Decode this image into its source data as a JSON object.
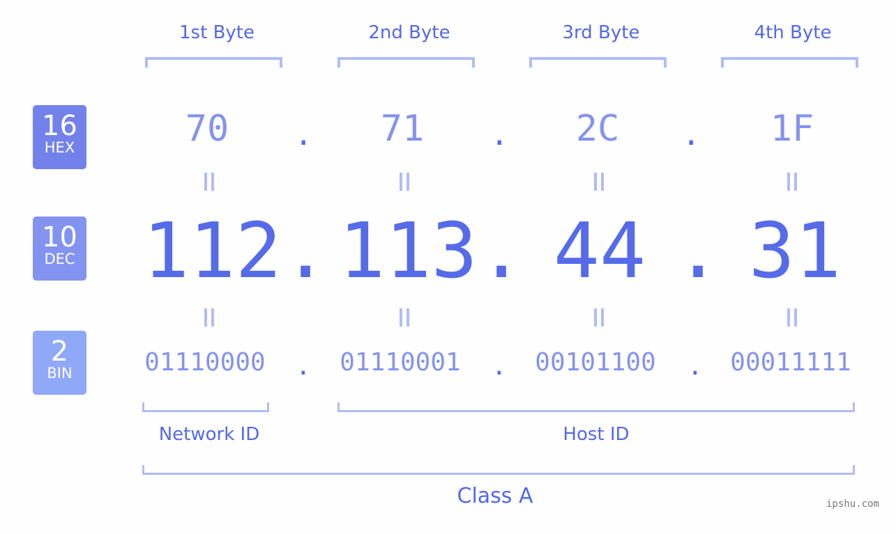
{
  "badges": [
    {
      "num": "16",
      "label": "HEX",
      "color": "#7382ea"
    },
    {
      "num": "10",
      "label": "DEC",
      "color": "#8393f0"
    },
    {
      "num": "2",
      "label": "BIN",
      "color": "#8fa8f8"
    }
  ],
  "bytes": [
    {
      "label": "1st Byte",
      "hex": "70",
      "dec": "112",
      "bin": "01110000"
    },
    {
      "label": "2nd Byte",
      "hex": "71",
      "dec": "113",
      "bin": "01110001"
    },
    {
      "label": "3rd Byte",
      "hex": "2C",
      "dec": "44",
      "bin": "00101100"
    },
    {
      "label": "4th Byte",
      "hex": "1F",
      "dec": "31",
      "bin": "00011111"
    }
  ],
  "separator": ".",
  "network_id_label": "Network ID",
  "host_id_label": "Host ID",
  "class_label": "Class A",
  "watermark": "ipshu.com"
}
